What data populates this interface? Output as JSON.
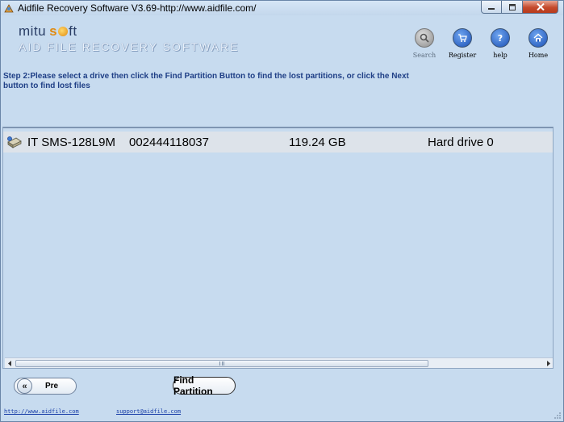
{
  "window": {
    "title": "Aidfile Recovery Software V3.69-http://www.aidfile.com/",
    "controls": [
      "minimize",
      "maximize",
      "close"
    ]
  },
  "logo": {
    "brand_left": "mitu",
    "brand_right": "ft",
    "tagline": "AID FILE RECOVERY SOFTWARE"
  },
  "toolbar": {
    "items": [
      {
        "label": "Search",
        "icon": "search-icon",
        "enabled": false
      },
      {
        "label": "Register",
        "icon": "cart-icon",
        "enabled": true
      },
      {
        "label": "help",
        "icon": "question-icon",
        "enabled": true
      },
      {
        "label": "Home",
        "icon": "home-icon",
        "enabled": true
      }
    ]
  },
  "instructions": "Step 2:Please select a drive then click the Find Partition Button to find the lost partitions, or click the Next button to find lost files",
  "drives": [
    {
      "name": "IT SMS-128L9M",
      "serial": "002444118037",
      "size": "119.24 GB",
      "type": "Hard drive 0",
      "selected": true
    }
  ],
  "buttons": {
    "pre": "Pre",
    "find_partition": "Find Partition"
  },
  "footer": {
    "website": "http://www.aidfile.com",
    "email": "support@aidfile.com"
  },
  "colors": {
    "window_bg": "#c7dbef",
    "row_selected_bg": "#dde3ea",
    "instruction_text": "#1f3f86",
    "link": "#1a3fa8",
    "close_button": "#c44a2d"
  }
}
